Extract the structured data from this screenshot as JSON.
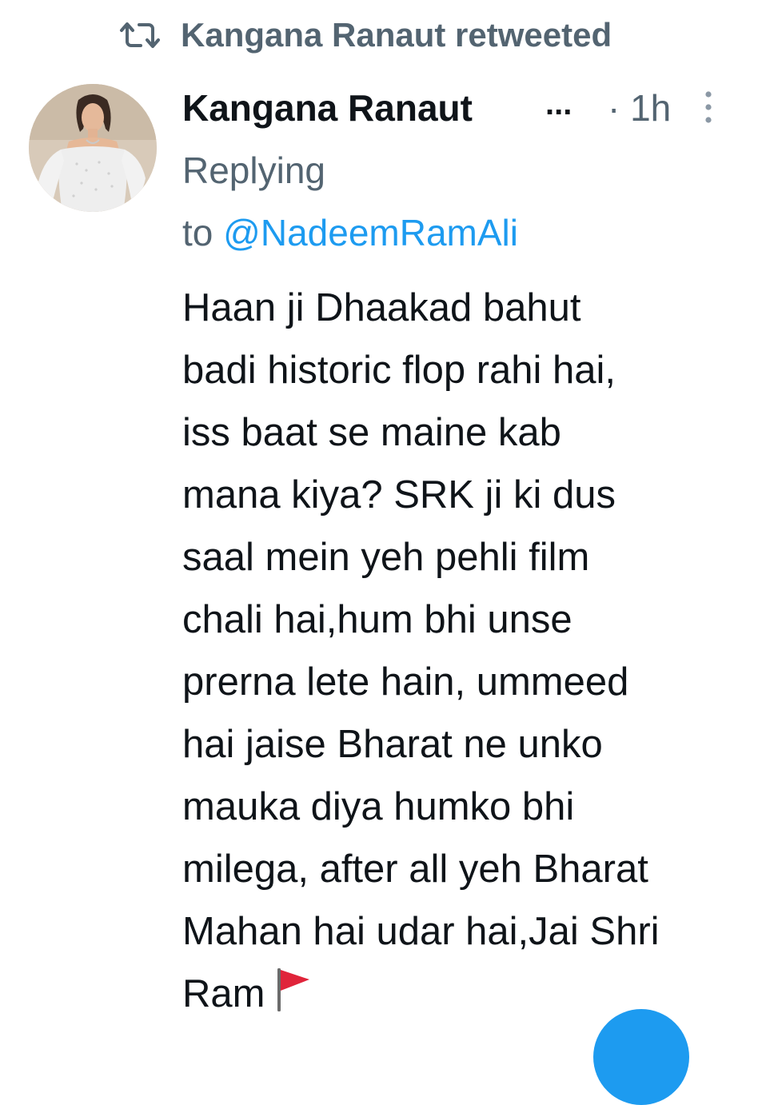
{
  "retweet_header": {
    "text": "Kangana Ranaut retweeted",
    "icon": "retweet-icon"
  },
  "tweet": {
    "author_name": "Kangana Ranaut",
    "name_truncation": "...",
    "timestamp": "· 1h",
    "reply_prefix_line1": "Replying",
    "reply_prefix_line2": "to",
    "reply_to": "@NadeemRamAli",
    "body_lines": [
      "Haan ji Dhaakad bahut",
      "badi historic flop rahi hai,",
      "iss baat se maine kab",
      "mana kiya? SRK ji ki dus",
      "saal mein yeh pehli film",
      "chali hai,hum bhi unse",
      "prerna lete hain, ummeed",
      "hai jaise Bharat ne unko",
      "mauka diya humko bhi",
      "milega, after all yeh Bharat",
      "Mahan hai udar hai,Jai Shri",
      "Ram"
    ],
    "trailing_emoji": "triangular-flag-icon"
  },
  "colors": {
    "text_primary": "#0f1419",
    "text_secondary": "#536471",
    "accent": "#1d9bf0",
    "flag_red": "#e0243a",
    "background": "#ffffff"
  }
}
